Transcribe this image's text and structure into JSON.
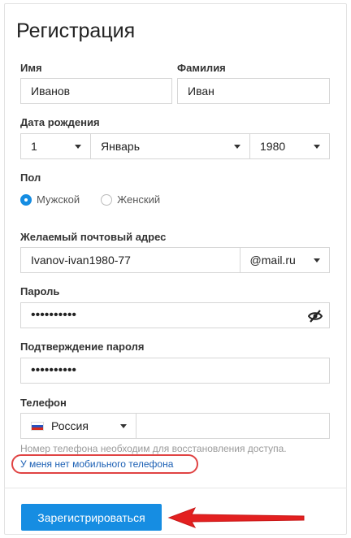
{
  "form": {
    "title": "Регистрация",
    "first_name": {
      "label": "Имя",
      "value": "Иванов"
    },
    "last_name": {
      "label": "Фамилия",
      "value": "Иван"
    },
    "birth_date": {
      "label": "Дата рождения",
      "day": "1",
      "month": "Январь",
      "year": "1980"
    },
    "gender": {
      "label": "Пол",
      "options": [
        "Мужской",
        "Женский"
      ],
      "selected": "Мужской"
    },
    "email": {
      "label": "Желаемый почтовый адрес",
      "value": "Ivanov-ivan1980-77",
      "domain": "@mail.ru"
    },
    "password": {
      "label": "Пароль",
      "value": "••••••••••"
    },
    "password_confirm": {
      "label": "Подтверждение пароля",
      "value": "••••••••••"
    },
    "phone": {
      "label": "Телефон",
      "country": "Россия",
      "value": ""
    },
    "phone_hint": "Номер телефона необходим для восстановления доступа.",
    "no_phone_link": "У меня нет мобильного телефона",
    "submit_label": "Зарегистрироваться"
  },
  "colors": {
    "accent": "#168de2",
    "annotation": "#e04343",
    "link": "#1a5fb4"
  },
  "icons": [
    "chevron-down-icon",
    "eye-slash-icon",
    "russia-flag-icon",
    "red-arrow-icon"
  ]
}
